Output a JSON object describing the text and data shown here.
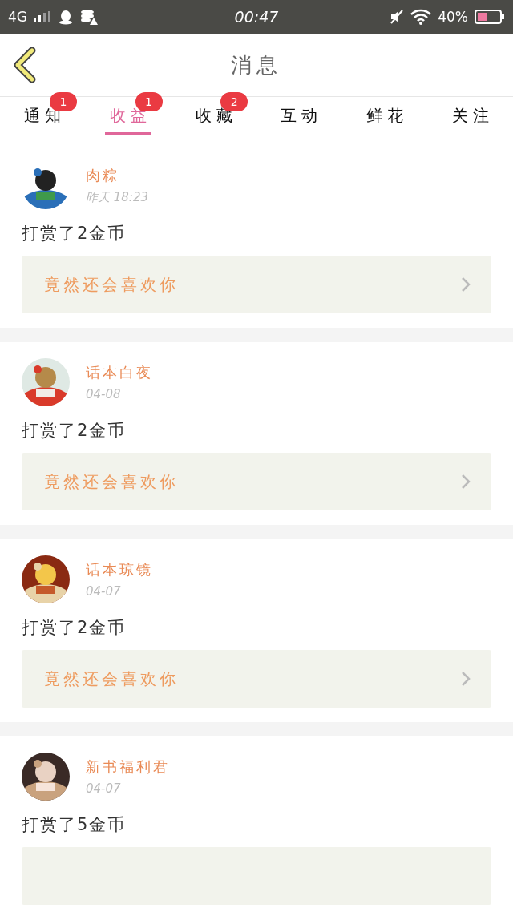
{
  "status_bar": {
    "network": "4G",
    "time": "00:47",
    "battery_text": "40%"
  },
  "header": {
    "title": "消息"
  },
  "tabs": [
    {
      "label": "通知",
      "selected": false,
      "badge": "1"
    },
    {
      "label": "收益",
      "selected": true,
      "badge": "1"
    },
    {
      "label": "收藏",
      "selected": false,
      "badge": "2"
    },
    {
      "label": "互动",
      "selected": false
    },
    {
      "label": "鲜花",
      "selected": false
    },
    {
      "label": "关注",
      "selected": false
    }
  ],
  "messages": [
    {
      "name": "肉粽",
      "time": "昨天 18:23",
      "text": "打赏了2金币",
      "quote": "竟然还会喜欢你"
    },
    {
      "name": "话本白夜",
      "time": "04-08",
      "text": "打赏了2金币",
      "quote": "竟然还会喜欢你"
    },
    {
      "name": "话本琼镜",
      "time": "04-07",
      "text": "打赏了2金币",
      "quote": "竟然还会喜欢你"
    },
    {
      "name": "新书福利君",
      "time": "04-07",
      "text": "打赏了5金币"
    }
  ]
}
